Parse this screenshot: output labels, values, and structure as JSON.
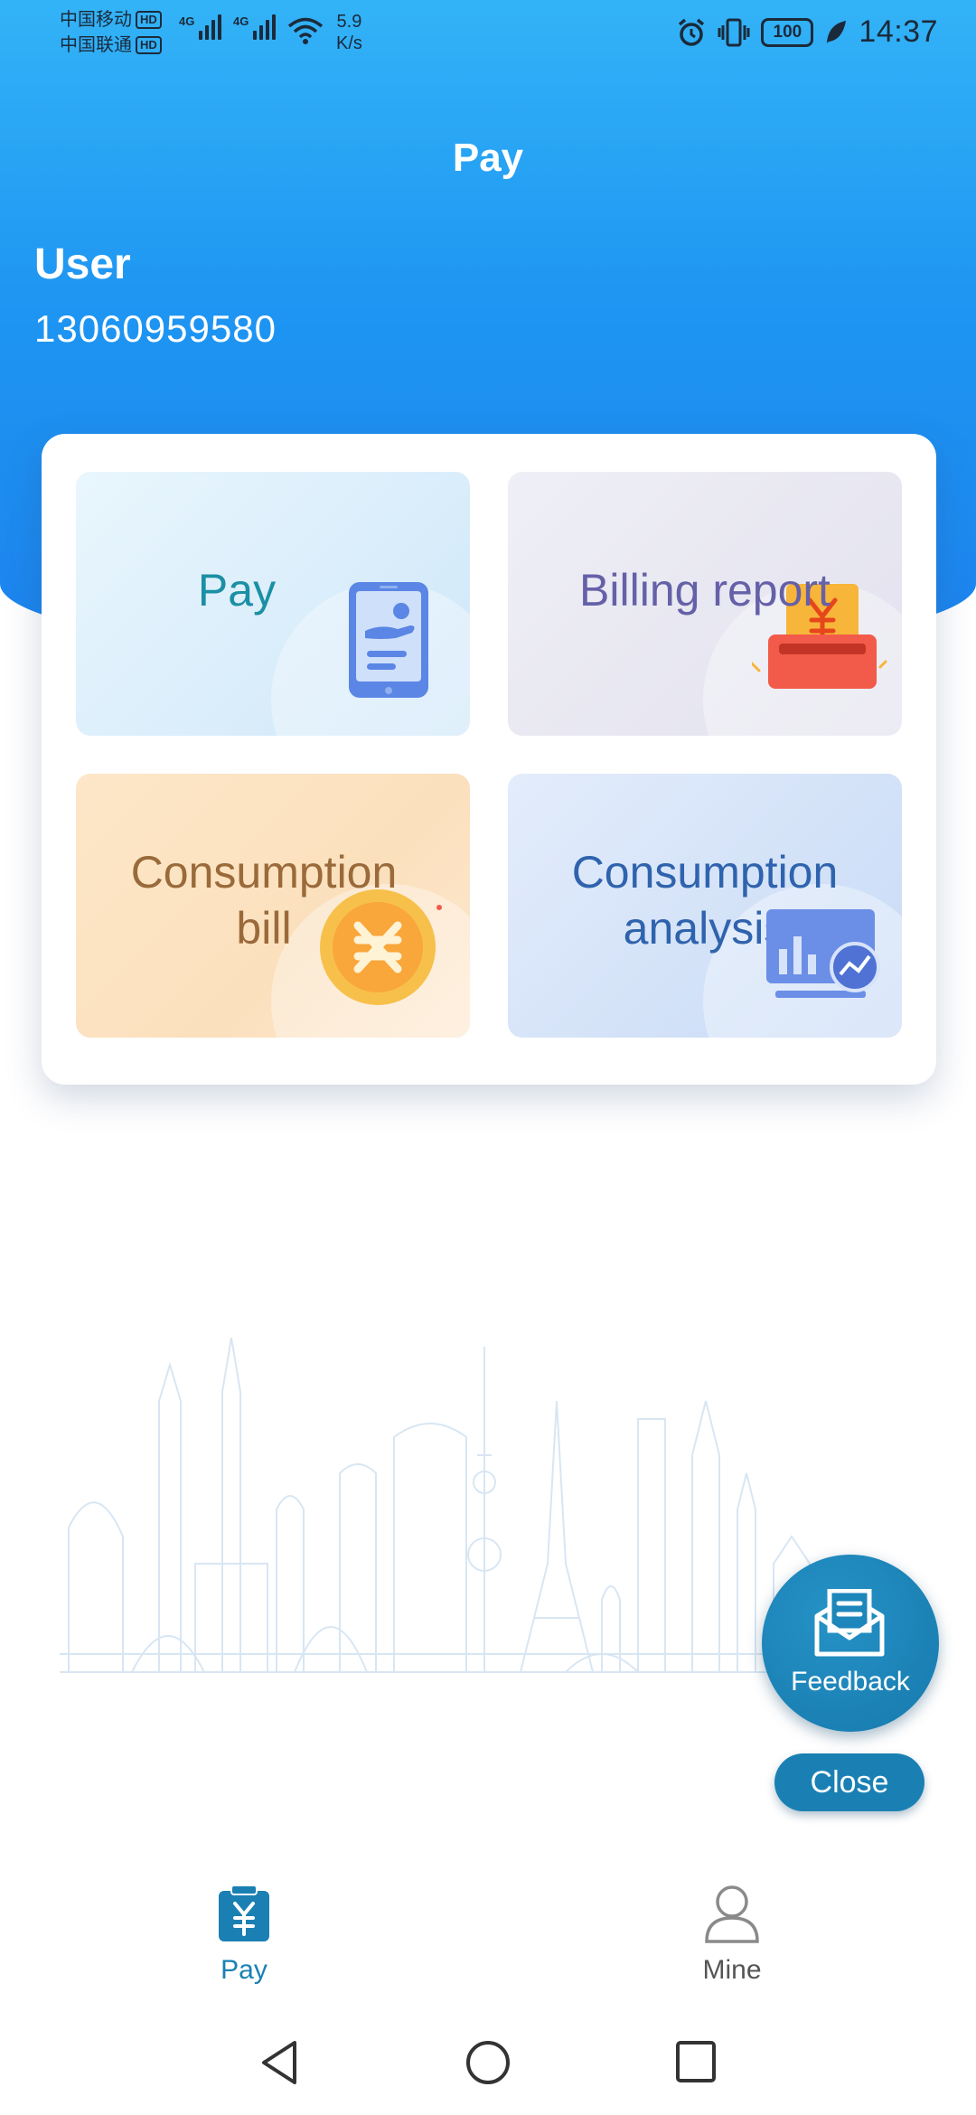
{
  "status_bar": {
    "carrier_1": "中国移动",
    "carrier_2": "中国联通",
    "hd_badge": "HD",
    "signal_type_1": "4G",
    "signal_type_2": "4G",
    "net_speed_value": "5.9",
    "net_speed_unit": "K/s",
    "battery": "100",
    "time": "14:37"
  },
  "header": {
    "title": "Pay",
    "user_label": "User",
    "user_phone": "13060959580"
  },
  "menu": {
    "pay": "Pay",
    "billing_report": "Billing report",
    "consumption_bill_line1": "Consumption",
    "consumption_bill_line2": "bill",
    "consumption_analysis_line1": "Consumption",
    "consumption_analysis_line2": "analysis"
  },
  "feedback": {
    "label": "Feedback",
    "close": "Close"
  },
  "bottom_nav": {
    "items": [
      {
        "label": "Pay",
        "icon": "pay-yuan-icon",
        "active": true
      },
      {
        "label": "Mine",
        "icon": "person-icon",
        "active": false
      }
    ]
  },
  "colors": {
    "header_blue": "#1e96f2",
    "accent": "#1a80b4",
    "pay_text": "#1b8fa3",
    "billing_text": "#6561a8",
    "bill_text": "#9a6a3a",
    "analysis_text": "#2f63ad"
  },
  "icons": [
    "alarm-icon",
    "vibrate-icon",
    "battery-icon",
    "leaf-icon",
    "wifi-icon",
    "envelope-icon",
    "back-icon",
    "home-icon",
    "recents-icon"
  ]
}
